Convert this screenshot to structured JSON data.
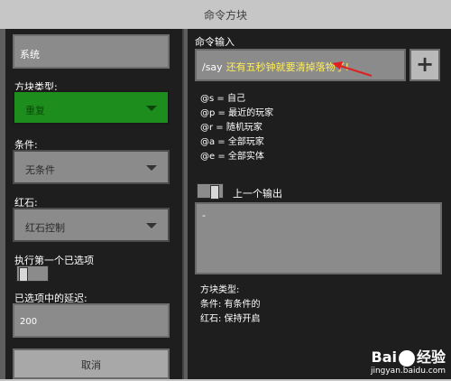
{
  "window": {
    "title": "命令方块"
  },
  "left": {
    "name_value": "系统",
    "block_type_label": "方块类型:",
    "block_type_value": "重复",
    "condition_label": "条件:",
    "condition_value": "无条件",
    "redstone_label": "红石:",
    "redstone_value": "红石控制",
    "exec_first_label": "执行第一个已选项",
    "delay_label": "已选项中的延迟:",
    "delay_value": "200",
    "cancel_label": "取消"
  },
  "right": {
    "command_label": "命令输入",
    "command_slash": "/say",
    "command_text": "还有五秒钟就要清掉落物了!",
    "plus_label": "+",
    "selectors": [
      "@s = 自己",
      "@p = 最近的玩家",
      "@r = 随机玩家",
      "@a = 全部玩家",
      "@e = 全部实体"
    ],
    "prev_output_label": "上一个输出",
    "output_value": "-",
    "info_block_type": "方块类型:",
    "info_condition": "条件: 有条件的",
    "info_redstone": "红石: 保持开启"
  },
  "watermark": {
    "brand_left": "Bai",
    "brand_right": "经验",
    "url": "jingyan.baidu.com"
  },
  "colors": {
    "command_text": "#ffee55",
    "active_dropdown": "#1d8e1d",
    "annotation": "#e02020"
  }
}
